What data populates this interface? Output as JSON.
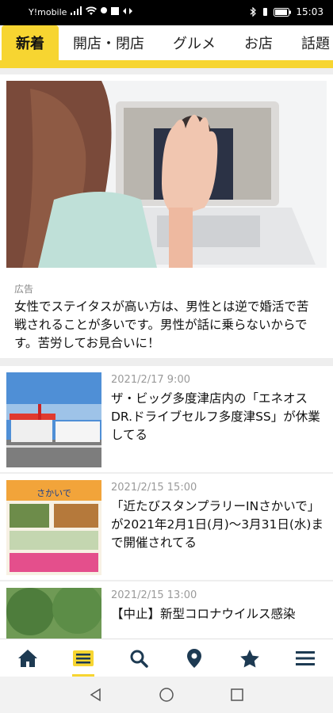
{
  "status_bar": {
    "carrier": "Y!mobile",
    "time": "15:03"
  },
  "tabs": [
    {
      "label": "新着",
      "active": true
    },
    {
      "label": "開店・閉店",
      "active": false
    },
    {
      "label": "グルメ",
      "active": false
    },
    {
      "label": "お店",
      "active": false
    },
    {
      "label": "話題",
      "active": false
    }
  ],
  "ad": {
    "label": "広告",
    "text": "女性でステイタスが高い方は、男性とは逆で婚活で苦戦されることが多いです。男性が話に乗らないからです。苦労してお見合いに！"
  },
  "news": [
    {
      "date": "2021/2/17 9:00",
      "title": "ザ・ビッグ多度津店内の「エネオスDR.ドライブセルフ多度津SS」が休業してる"
    },
    {
      "date": "2021/2/15 15:00",
      "title": "「近たびスタンプラリーINさかいで」が2021年2月1日(月)〜3月31日(水)まで開催されてる",
      "poster_text": "さかいで"
    },
    {
      "date": "2021/2/15 13:00",
      "title": "【中止】新型コロナウイルス感染"
    }
  ],
  "colors": {
    "accent": "#f7d531"
  },
  "bottom_nav": [
    {
      "icon": "home-icon"
    },
    {
      "icon": "news-icon",
      "active": true
    },
    {
      "icon": "search-icon"
    },
    {
      "icon": "map-pin-icon"
    },
    {
      "icon": "star-icon"
    },
    {
      "icon": "menu-icon"
    }
  ]
}
